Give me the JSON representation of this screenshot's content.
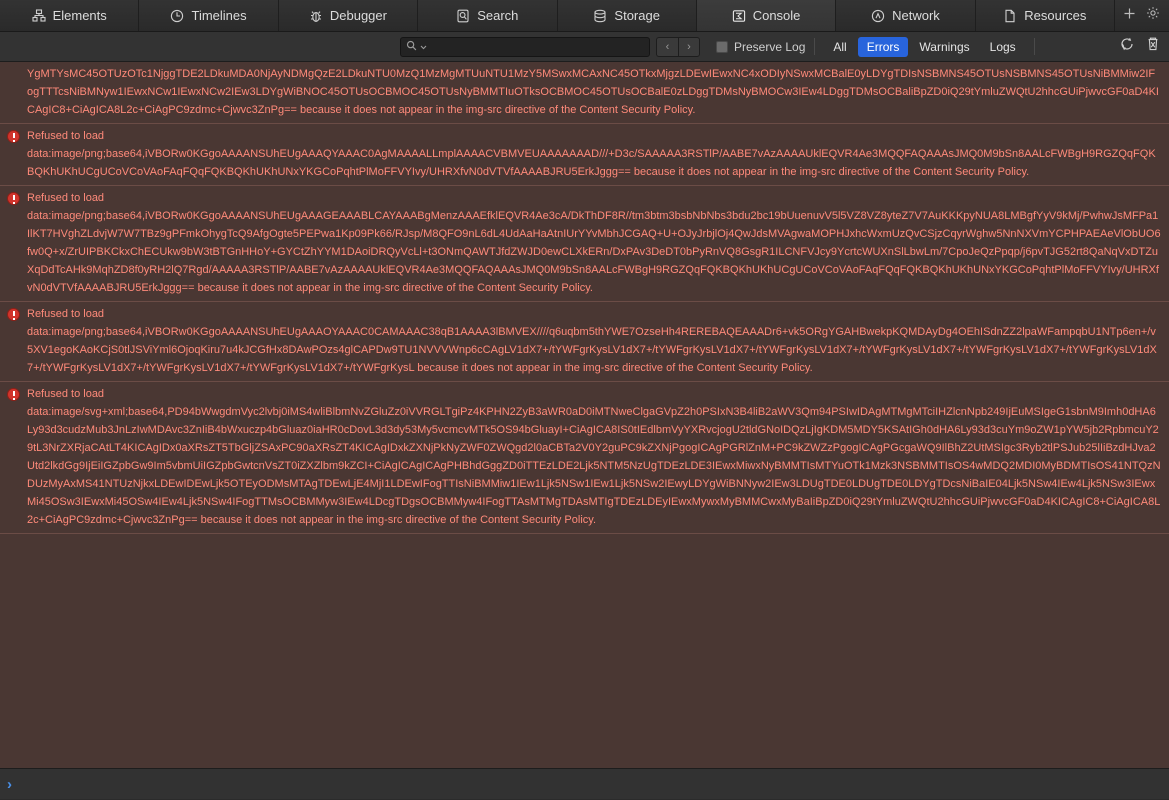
{
  "tabs": [
    {
      "label": "Elements",
      "icon": "elements-icon",
      "active": false
    },
    {
      "label": "Timelines",
      "icon": "clock-icon",
      "active": false
    },
    {
      "label": "Debugger",
      "icon": "bug-icon",
      "active": false
    },
    {
      "label": "Search",
      "icon": "search-icon",
      "active": false
    },
    {
      "label": "Storage",
      "icon": "database-icon",
      "active": false
    },
    {
      "label": "Console",
      "icon": "console-icon",
      "active": true
    },
    {
      "label": "Network",
      "icon": "network-icon",
      "active": false
    },
    {
      "label": "Resources",
      "icon": "document-icon",
      "active": false
    }
  ],
  "tabbar": {
    "add_label": "+",
    "settings_icon": "gear-icon"
  },
  "toolbar": {
    "search_placeholder": "",
    "search_value": "",
    "search_icon": "search-icon",
    "search_dropdown_icon": "chevron-down-icon",
    "prev_label": "‹",
    "next_label": "›",
    "preserve_log_label": "Preserve Log",
    "preserve_log_checked": true,
    "filters": [
      {
        "label": "All",
        "selected": false
      },
      {
        "label": "Errors",
        "selected": true
      },
      {
        "label": "Warnings",
        "selected": false
      },
      {
        "label": "Logs",
        "selected": false
      }
    ],
    "reload_icon": "reload-icon",
    "clear_icon": "trash-icon",
    "accent_color": "#2864dc"
  },
  "console": {
    "background_color": "#4a3733",
    "text_color": "#ff8a7a",
    "messages": [
      {
        "level": "error",
        "clipped": true,
        "title": "",
        "detail": "YgMTYsMC45OTUzOTc1NjggTDE2LDkuMDA0NjAyNDMgQzE2LDkuNTU0MzQ1MzMgMTUuNTU1MzY5MSwxMCAxNC45OTkxMjgzLDEwIEwxNC4xODIyNSwxMCBalE0yLDYgTDIsNSBMNS45OTUsNSBMNS45OTUsNiBMMiw2IFogTTTcsNiBMNyw1IEwxNCw1IEwxNCw2IEw3LDYgWiBNOC45OTUsOCBMOC45OTUsNyBMMTIuOTksOCBMOC45OTUsOCBalE0zLDggTDMsNyBMOCw3IEw4LDggTDMsOCBaliBpZD0iQ29tYmluZWQtU2hhcGUiPjwvcGF0aD4KICAgIC8+CiAgICA8L2c+CiAgPC9zdmc+Cjwvc3ZnPg== because it does not appear in the img-src directive of the Content Security Policy."
      },
      {
        "level": "error",
        "clipped": false,
        "title": "Refused to load",
        "detail": "data:image/png;base64,iVBORw0KGgoAAAANSUhEUgAAAQYAAAC0AgMAAAALLmplAAAACVBMVEUAAAAAAAD///+D3c/SAAAAA3RSTlP/AABE7vAzAAAAUklEQVR4Ae3MQQFAQAAAsJMQ0M9bSn8AALcFWBgH9RGZQqFQKBQKhUKhUCgUCoVCoVAoFAqFQqFQKBQKhUKhUNxYKGCoPqhtPlMoFFVYIvy/UHRXfvN0dVTVfAAAABJRU5ErkJggg== because it does not appear in the img-src directive of the Content Security Policy."
      },
      {
        "level": "error",
        "clipped": false,
        "title": "Refused to load",
        "detail": "data:image/png;base64,iVBORw0KGgoAAAANSUhEUgAAAGEAAABLCAYAAABgMenzAAAEfklEQVR4Ae3cA/DkThDF8R//tm3btm3bsbNbNbs3bdu2bc19bUuenuvV5l5VZ8VZ8yteZ7V7AuKKKpyNUA8LMBgfYyV9kMj/PwhwJsMFPa1IlKT7HVghZLdvjW7W7TBz9gPFmkOhygTcQ9AfgOgte5PEPwa1Kp09Pk66/RJsp/M8QFO9nL6dL4UdAaHaAtnIUrYYvMbhJCGAQ+U+OJyJrbjlOj4QwJdsMVAgwaMOPHJxhcWxmUzQvCSjzCqyrWghw5NnNXVmYCPHPAEAeVlObUO6fw0Q+x/ZrUIPBKCkxChECUkw9bW3tBTGnHHoY+GYCtZhYYM1DAoiDRQyVcLl+t3ONmQAWTJfdZWJD0ewCLXkERn/DxPAv3DeDT0bPyRnVQ8GsgR1ILCNFVJcy9YcrtcWUXnSlLbwLm/7CpoJeQzPpqp/j6pvTJG52rt8QaNqVxDTZuXqDdTcAHk9MqhZD8f0yRH2lQ7Rgd/AAAAA3RSTlP/AABE7vAzAAAAUklEQVR4Ae3MQQFAQAAAsJMQ0M9bSn8AALcFWBgH9RGZQqFQKBQKhUKhUCgUCoVCoVAoFAqFQqFQKBQKhUKhUNxYKGCoPqhtPlMoFFVYIvy/UHRXfvN0dVTVfAAAABJRU5ErkJggg== because it does not appear in the img-src directive of the Content Security Policy."
      },
      {
        "level": "error",
        "clipped": false,
        "title": "Refused to load",
        "detail": "data:image/png;base64,iVBORw0KGgoAAAANSUhEUgAAAOYAAAC0CAMAAAC38qB1AAAA3lBMVEX////q6uqbm5thYWE7OzseHh4REREBAQEAAADr6+vk5ORgYGAHBwekpKQMDAyDg4OEhISdnZZ2lpaWFampqbU1NTp6en+/v5XV1egoKAoKCjS0tlJSViYml6OjoqKiru7u4kJCGfHx8DAwPOzs4glCAPDw9TU1NVVVWnp6cCAgLV1dX7+/tYWFgrKysLV1dX7+/tYWFgrKysLV1dX7+/tYWFgrKysLV1dX7+/tYWFgrKysLV1dX7+/tYWFgrKysLV1dX7+/tYWFgrKysLV1dX7+/tYWFgrKysLV1dX7+/tYWFgrKysLV1dX7+/tYWFgrKysLV1dX7+/tYWFgrKysL because it does not appear in the img-src directive of the Content Security Policy."
      },
      {
        "level": "error",
        "clipped": false,
        "title": "Refused to load",
        "detail": "data:image/svg+xml;base64,PD94bWwgdmVyc2lvbj0iMS4wliBlbmNvZGluZz0iVVRGLTgiPz4KPHN2ZyB3aWR0aD0iMTNweClgaGVpZ2h0PSIxN3B4liB2aWV3Qm94PSIwIDAgMTMgMTciIHZlcnNpb249IjEuMSIgeG1sbnM9Imh0dHA6Ly93d3cudzMub3JnLzIwMDAvc3ZnIiB4bWxuczp4bGluaz0iaHR0cDovL3d3dy53My5vcmcvMTk5OS94bGluayI+CiAgICA8IS0tIEdlbmVyYXRvcjogU2tldGNoIDQzLjIgKDM5MDY5KSAtIGh0dHA6Ly93d3cuYm9oZW1pYW5jb2RpbmcuY29tL3NrZXRjaCAtLT4KICAgIDx0aXRsZT5TbGljZSAxPC90aXRsZT4KICAgIDxkZXNjPkNyZWF0ZWQgd2l0aCBTa2V0Y2guPC9kZXNjPgogICAgPGRlZnM+PC9kZWZzPgogICAgPGcgaWQ9IlBhZ2UtMSIgc3Ryb2tlPSJub25lIiBzdHJva2Utd2lkdGg9IjEiIGZpbGw9Im5vbmUiIGZpbGwtcnVsZT0iZXZlbm9kZCI+CiAgICAgICAgPHBhdGggZD0iTTEzLDE2Ljk5NTM5NzUgTDEzLDE3IEwxMiwxNyBMMTIsMTYuOTk1Mzk3NSBMMTIsOS4wMDQ2MDI0MyBDMTIsOS41NTQzNDUzMyAxMS41NTUzNjkxLDEwIDEwLjk5OTEyODMsMTAgTDEwLjE4MjI1LDEwIFogTTIsNiBMMiw1IEw1Ljk5NSw1IEw1Ljk5NSw2IEwyLDYgWiBNNyw2IEw3LDUgTDE0LDUgTDE0LDYgTDcsNiBaIE04Ljk5NSw4IEw4Ljk5NSw3IEwxMi45OSw3IEwxMi45OSw4IEw4Ljk5NSw4IFogTTMsOCBMMyw3IEw4LDcgTDgsOCBMMyw4IFogTTAsMTMgTDAsMTIgTDEzLDEyIEwxMywxMyBMMCwxMyBaIiBpZD0iQ29tYmluZWQtU2hhcGUiPjwvcGF0aD4KICAgIC8+CiAgICA8L2c+CiAgPC9zdmc+Cjwvc3ZnPg== because it does not appear in the img-src directive of the Content Security Policy."
      }
    ]
  },
  "prompt": {
    "chevron": "›",
    "value": "",
    "placeholder": ""
  }
}
